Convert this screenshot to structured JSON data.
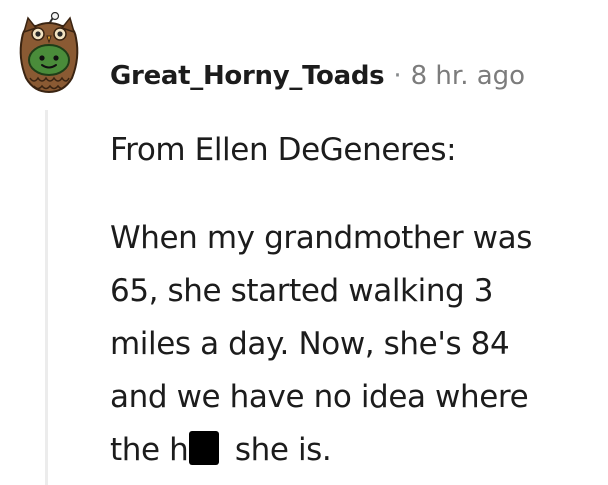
{
  "comment": {
    "author": "Great_Horny_Toads",
    "separator": "·",
    "time_ago": "8 hr. ago",
    "avatar_icon": "snoo-owl-costume-avatar-icon",
    "redaction_icon": "black-censor-bar",
    "paragraphs": [
      {
        "lines": [
          "From Ellen DeGeneres:"
        ]
      },
      {
        "lines": [
          "When my grandmother was",
          "65, she started walking 3",
          "miles a day. Now, she's 84",
          "and we have no idea where"
        ],
        "last_line": {
          "before": "the h",
          "after": " she is."
        }
      }
    ]
  },
  "colors": {
    "text": "#1c1c1c",
    "meta": "#7c7c7c",
    "thread_line": "#ececec",
    "avatar_green": "#4a8c3a",
    "avatar_brown": "#8a5a33"
  }
}
